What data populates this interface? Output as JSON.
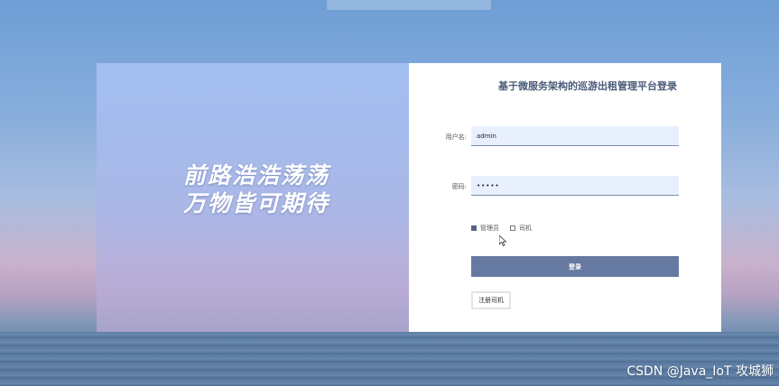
{
  "slogan": {
    "line1": "前路浩浩荡荡",
    "line2": "万物皆可期待"
  },
  "login": {
    "title": "基于微服务架构的巡游出租管理平台登录",
    "username_label": "用户名:",
    "username_value": "admin",
    "password_label": "密码:",
    "password_value": "•••••",
    "roles": [
      {
        "label": "管理员",
        "checked": true
      },
      {
        "label": "司机",
        "checked": false
      }
    ],
    "login_button": "登录",
    "register_button": "注册司机"
  },
  "watermark": "CSDN @Java_IoT 攻城狮",
  "colors": {
    "accent": "#6679a0",
    "input_bg": "#e8f0fe"
  }
}
